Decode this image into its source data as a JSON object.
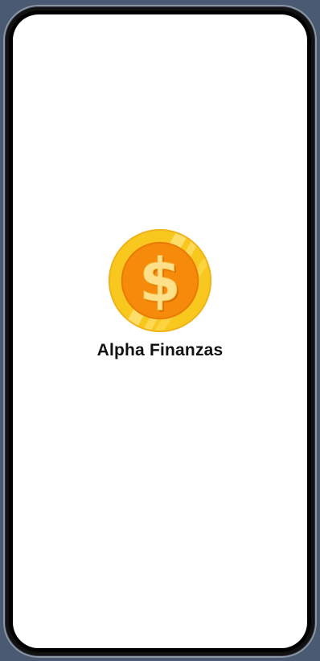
{
  "app": {
    "name": "Alpha Finanzas",
    "logo_icon": "coin-dollar-icon"
  },
  "colors": {
    "background": "#4a5a72",
    "screen": "#ffffff",
    "coin_outer": "#f7c52a",
    "coin_inner": "#f58a0b",
    "dollar": "#fde08a",
    "title": "#111111"
  }
}
